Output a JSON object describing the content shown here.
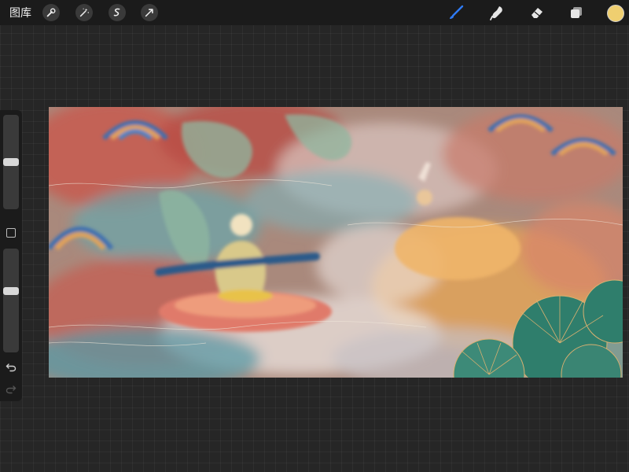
{
  "toolbar": {
    "gallery_label": "图库",
    "left_tools": [
      "wrench-icon",
      "magic-wand-icon",
      "selection-icon",
      "transform-arrow-icon"
    ],
    "right_tools": [
      "brush-icon",
      "smudge-icon",
      "eraser-icon",
      "layers-icon"
    ],
    "active_tool": "brush-icon",
    "accent_color": "#2f7bf5",
    "current_color": "#efcf70"
  },
  "sidebar": {
    "brush_size_level": 0.5,
    "opacity_level": 0.6,
    "undo_icon": "undo-icon",
    "redo_icon": "redo-icon"
  },
  "canvas": {
    "artwork_colors": [
      "#c9574d",
      "#5a9aa6",
      "#e2a35a",
      "#3f6fb0",
      "#2f7e6c",
      "#ece3df"
    ]
  }
}
